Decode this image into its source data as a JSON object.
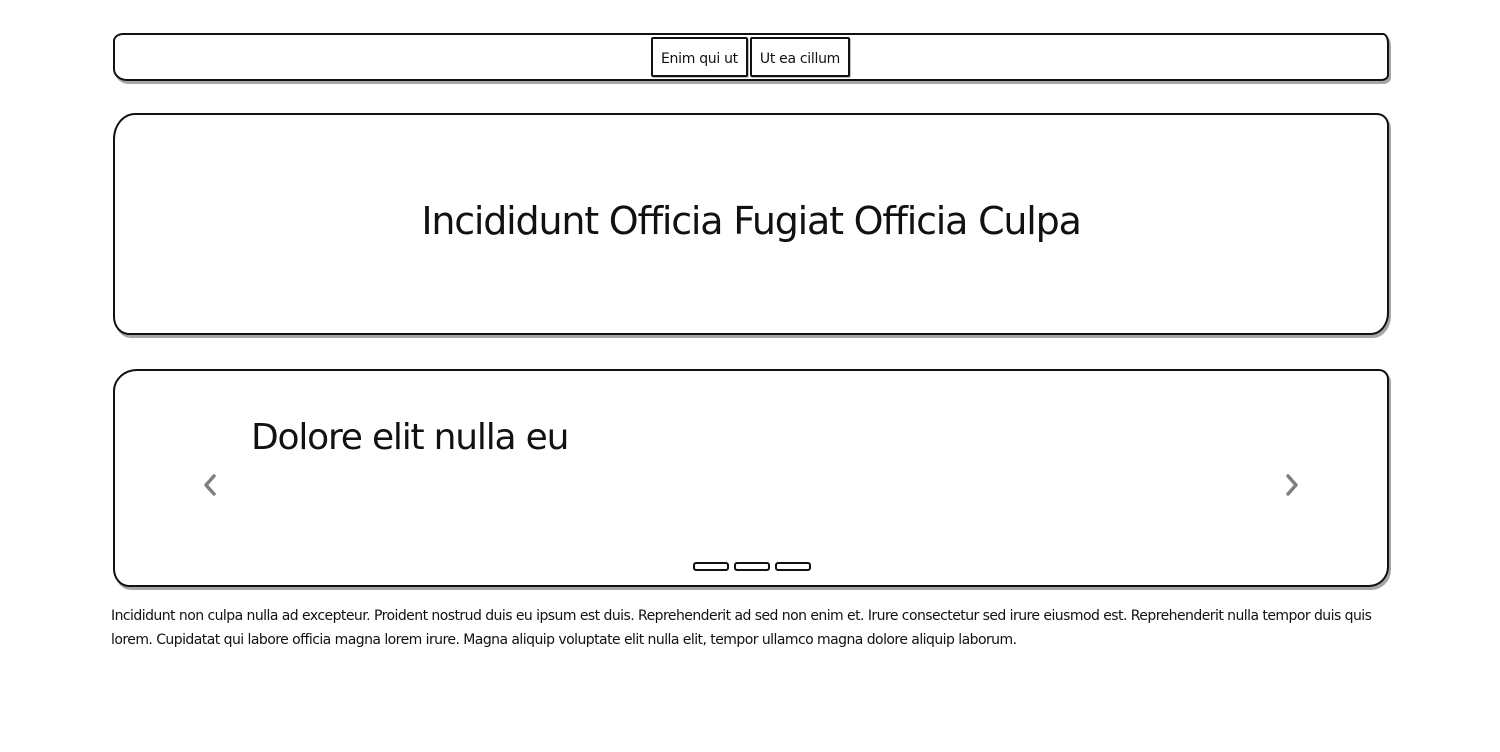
{
  "navbar": {
    "buttons": [
      {
        "label": "Enim qui ut"
      },
      {
        "label": "Ut ea cillum"
      }
    ]
  },
  "hero": {
    "title": "Incididunt Officia Fugiat Officia Culpa"
  },
  "carousel": {
    "slide_title": "Dolore elit nulla eu",
    "prev_icon": "chevron-left-icon",
    "next_icon": "chevron-right-icon",
    "indicator_count": 3,
    "arrow_color": "#7f7f7f"
  },
  "body": {
    "paragraph": "Incididunt non culpa nulla ad excepteur. Proident nostrud duis eu ipsum est duis. Reprehenderit ad sed non enim et. Irure consectetur sed irure eiusmod est. Reprehenderit nulla tempor duis quis lorem. Cupidatat qui labore officia magna lorem irure. Magna aliquip voluptate elit nulla elit, tempor ullamco magna dolore aliquip laborum."
  }
}
